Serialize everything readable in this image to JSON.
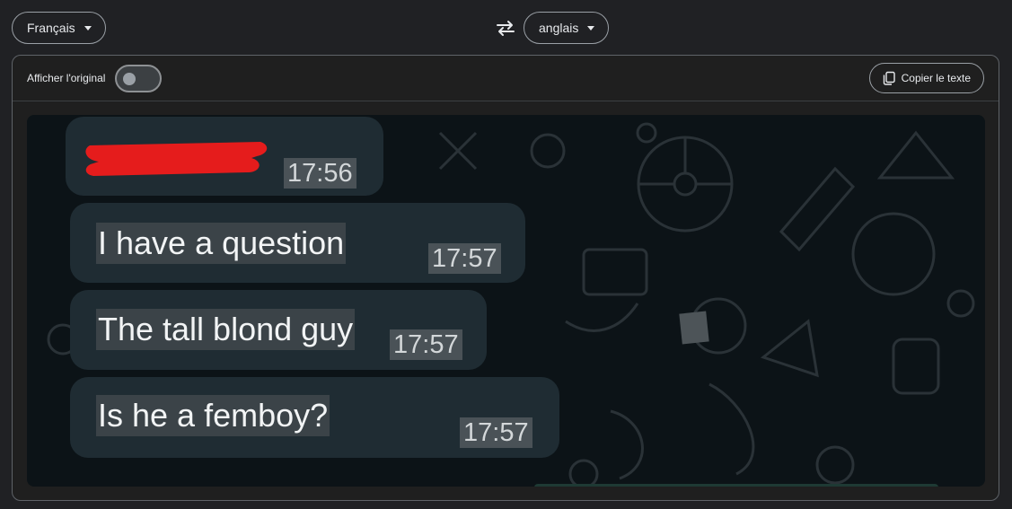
{
  "source_language": "Français",
  "target_language": "anglais",
  "toolbar": {
    "show_original_label": "Afficher l'original",
    "show_original_on": false,
    "copy_label": "Copier le texte"
  },
  "chat": {
    "messages": [
      {
        "text": "",
        "time": "17:56",
        "sender_redacted": true
      },
      {
        "text": "I have a question",
        "time": "17:57"
      },
      {
        "text": "The tall blond guy",
        "time": "17:57"
      },
      {
        "text": "Is he a femboy?",
        "time": "17:57"
      }
    ]
  },
  "icons": {
    "swap": "swap-languages-icon",
    "copy": "copy-icon",
    "dropdown": "chevron-down-icon"
  },
  "colors": {
    "background": "#202124",
    "chat_background": "#0c1317",
    "bubble": "#1f2c33",
    "redaction": "#e51c1c"
  }
}
